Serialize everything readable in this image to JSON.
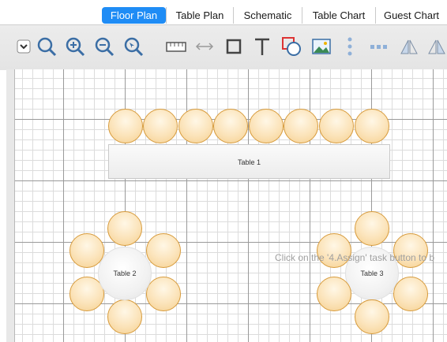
{
  "tabs": [
    {
      "label": "Floor Plan",
      "active": true
    },
    {
      "label": "Table Plan",
      "active": false
    },
    {
      "label": "Schematic",
      "active": false
    },
    {
      "label": "Table Chart",
      "active": false
    },
    {
      "label": "Guest Chart",
      "active": false
    }
  ],
  "toolbar": {
    "icons": [
      "dropdown-icon",
      "zoom-icon",
      "zoom-in-icon",
      "zoom-out-icon",
      "zoom-fit-icon",
      "ruler-icon",
      "arrows-icon",
      "rectangle-icon",
      "text-icon",
      "shapes-icon",
      "image-icon",
      "vertical-dots-icon",
      "horizontal-dots-icon",
      "flip-icon",
      "flip-icon"
    ]
  },
  "floor": {
    "tables": [
      {
        "label": "Table 1"
      },
      {
        "label": "Table 2"
      },
      {
        "label": "Table 3"
      }
    ],
    "hint": "Click on the '4.Assign' task button to b"
  },
  "colors": {
    "accent": "#1f8cf5",
    "seat": "#f5cf8e",
    "icon": "#3b6ea5"
  }
}
